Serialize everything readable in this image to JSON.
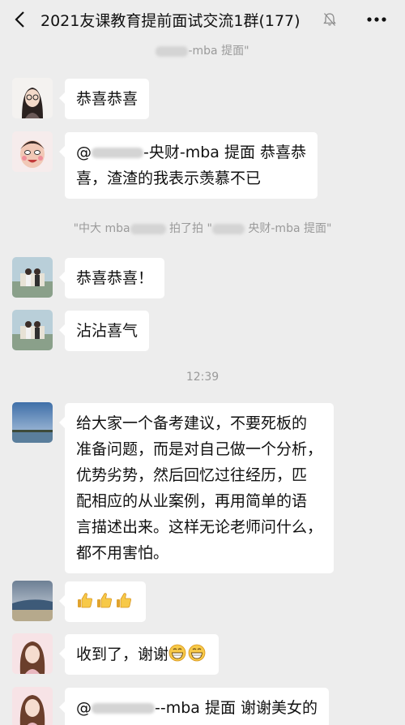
{
  "header": {
    "title": "2021友课教育提前面试交流1群(177)"
  },
  "system_messages": [
    {
      "suffix": "-mba 提面\""
    },
    {
      "prefix": "\"中大 mba",
      "middle": "拍了拍 \"",
      "suffix": "央财-mba 提面\""
    }
  ],
  "timestamp": "12:39",
  "messages": [
    {
      "lines": [
        "恭喜恭喜"
      ]
    },
    {
      "mention": "@",
      "line1_rest": "-央财-mba 提面  恭喜恭",
      "line2": "喜，渣渣的我表示羡慕不已"
    },
    {
      "lines": [
        "恭喜恭喜！"
      ]
    },
    {
      "lines": [
        "沾沾喜气"
      ]
    },
    {
      "lines": [
        "给大家一个备考建议，不要死板的",
        "准备问题，而是对自己做一个分析，",
        "优势劣势，然后回忆过往经历，匹",
        "配相应的从业案例，再用简单的语",
        "言描述出来。这样无论老师问什么，",
        "都不用害怕。"
      ]
    },
    {
      "emoji": "thumbs-up-icon",
      "count": 3
    },
    {
      "text": "收到了，谢谢",
      "emoji": "grin-icon",
      "count": 2
    },
    {
      "mention": "@",
      "line1_rest": "--mba 提面  谢谢美女的"
    }
  ],
  "colors": {
    "background": "#ededed",
    "bubble": "#ffffff",
    "system_text": "#9a9a9a",
    "text": "#111111"
  }
}
